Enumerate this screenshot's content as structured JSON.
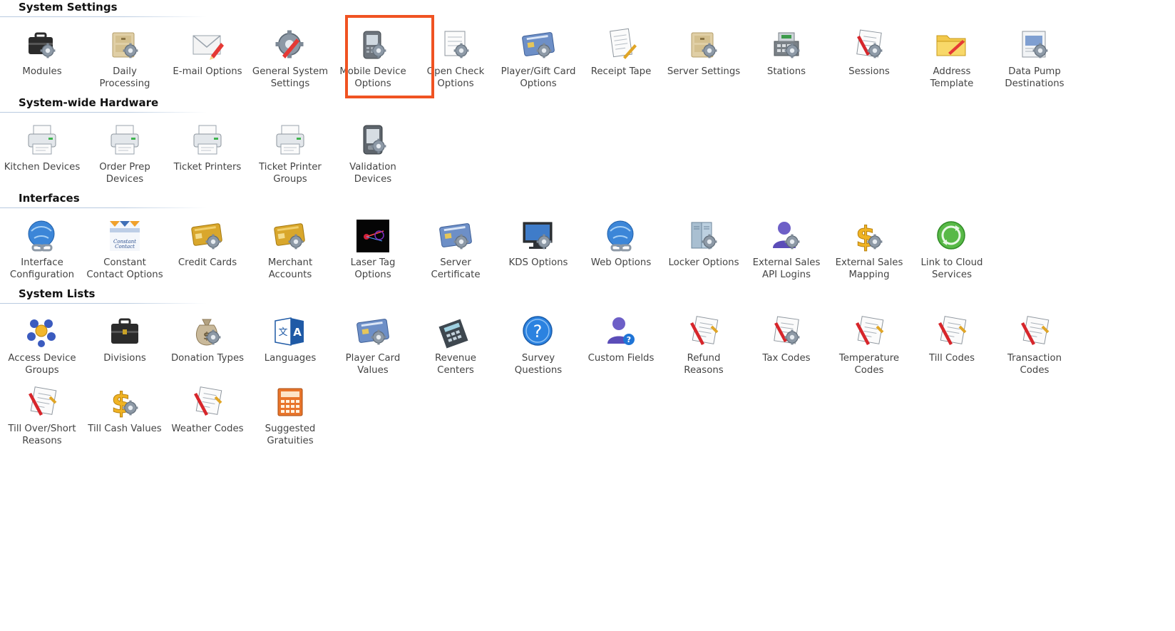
{
  "sections": [
    {
      "title": "System Settings",
      "items": [
        {
          "label": "Modules",
          "icon": "briefcase-gear-icon"
        },
        {
          "label": "Daily\nProcessing",
          "icon": "box-gear-icon"
        },
        {
          "label": "E-mail Options",
          "icon": "envelope-icon"
        },
        {
          "label": "General System\nSettings",
          "icon": "gear-icon"
        },
        {
          "label": "Mobile Device\nOptions",
          "icon": "mobile-device-icon"
        },
        {
          "label": "Open Check\nOptions",
          "icon": "receipt-gear-icon"
        },
        {
          "label": "Player/Gift Card\nOptions",
          "icon": "smart-card-icon"
        },
        {
          "label": "Receipt Tape",
          "icon": "receipt-icon"
        },
        {
          "label": "Server Settings",
          "icon": "box-gear-icon"
        },
        {
          "label": "Stations",
          "icon": "cash-register-icon"
        },
        {
          "label": "Sessions",
          "icon": "checklist-gear-icon"
        },
        {
          "label": "Address\nTemplate",
          "icon": "folder-icon"
        },
        {
          "label": "Data Pump\nDestinations",
          "icon": "data-pump-icon"
        }
      ]
    },
    {
      "title": "System-wide Hardware",
      "items": [
        {
          "label": "Kitchen Devices",
          "icon": "printer-icon"
        },
        {
          "label": "Order Prep\nDevices",
          "icon": "printer-icon"
        },
        {
          "label": "Ticket Printers",
          "icon": "printer-icon"
        },
        {
          "label": "Ticket Printer\nGroups",
          "icon": "printer-icon"
        },
        {
          "label": "Validation\nDevices",
          "icon": "validation-device-icon"
        }
      ]
    },
    {
      "title": "Interfaces",
      "items": [
        {
          "label": "Interface\nConfiguration",
          "icon": "globe-link-icon"
        },
        {
          "label": "Constant\nContact Options",
          "icon": "constant-contact-icon",
          "text": "Constant Contact"
        },
        {
          "label": "Credit Cards",
          "icon": "credit-card-icon"
        },
        {
          "label": "Merchant\nAccounts",
          "icon": "credit-card-icon"
        },
        {
          "label": "Laser Tag\nOptions",
          "icon": "laser-tag-icon"
        },
        {
          "label": "Server\nCertificate",
          "icon": "smart-card-icon"
        },
        {
          "label": "KDS Options",
          "icon": "monitor-gear-icon"
        },
        {
          "label": "Web Options",
          "icon": "globe-link-icon"
        },
        {
          "label": "Locker Options",
          "icon": "locker-icon"
        },
        {
          "label": "External Sales\nAPI Logins",
          "icon": "user-gear-icon"
        },
        {
          "label": "External Sales\nMapping",
          "icon": "dollar-gear-icon"
        },
        {
          "label": "Link to Cloud\nServices",
          "icon": "cloud-sync-icon"
        }
      ]
    },
    {
      "title": "System Lists",
      "items": [
        {
          "label": "Access Device\nGroups",
          "icon": "access-groups-icon"
        },
        {
          "label": "Divisions",
          "icon": "briefcase-icon"
        },
        {
          "label": "Donation Types",
          "icon": "money-bag-icon"
        },
        {
          "label": "Languages",
          "icon": "languages-icon"
        },
        {
          "label": "Player Card\nValues",
          "icon": "smart-card-icon"
        },
        {
          "label": "Revenue\nCenters",
          "icon": "calculator-icon"
        },
        {
          "label": "Survey\nQuestions",
          "icon": "question-icon"
        },
        {
          "label": "Custom Fields",
          "icon": "user-question-icon"
        },
        {
          "label": "Refund\nReasons",
          "icon": "checklist-icon"
        },
        {
          "label": "Tax Codes",
          "icon": "checklist-gear-icon"
        },
        {
          "label": "Temperature\nCodes",
          "icon": "checklist-icon"
        },
        {
          "label": "Till Codes",
          "icon": "checklist-icon"
        },
        {
          "label": "Transaction\nCodes",
          "icon": "checklist-icon"
        },
        {
          "label": "Till Over/Short\nReasons",
          "icon": "checklist-icon"
        },
        {
          "label": "Till Cash Values",
          "icon": "dollar-gear-icon"
        },
        {
          "label": "Weather Codes",
          "icon": "checklist-icon"
        },
        {
          "label": "Suggested\nGratuities",
          "icon": "calculator-orange-icon"
        }
      ]
    }
  ],
  "highlighted_item": "Mobile Device\nOptions",
  "colors": {
    "highlight": "#f05322",
    "section_rule": "#b9cbe0",
    "label": "#444444"
  }
}
